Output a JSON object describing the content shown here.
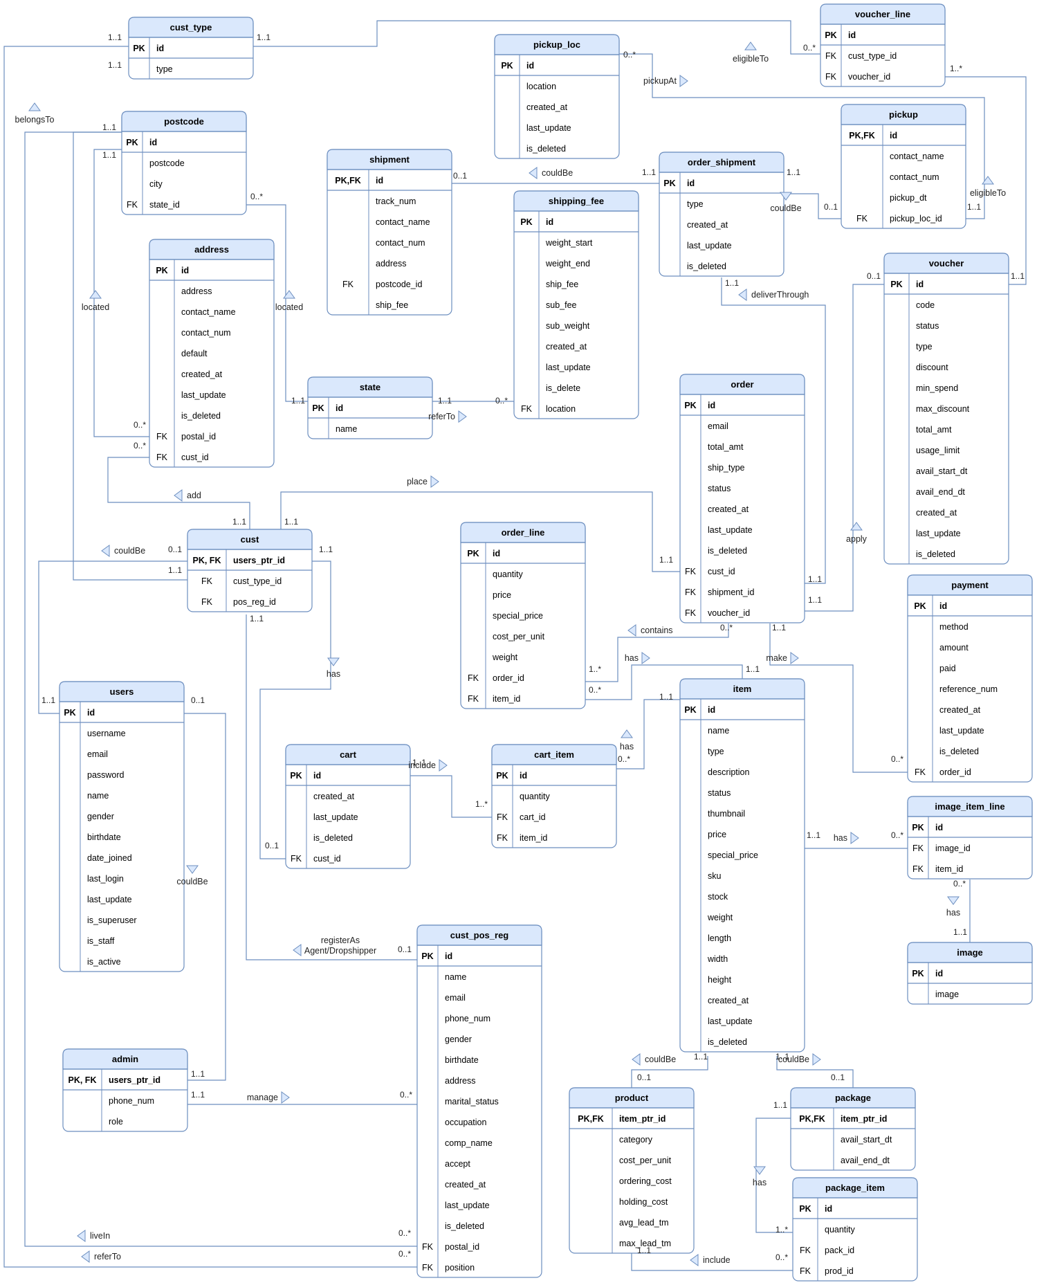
{
  "theme": {
    "line": "#6c8ebf",
    "header": "#dae8fc",
    "border": "#6c8ebf",
    "text": "#000000"
  },
  "entities": [
    {
      "id": "cust_type",
      "title": "cust_type",
      "rows": [
        [
          "PK",
          "id"
        ],
        [
          "",
          "type"
        ]
      ]
    },
    {
      "id": "postcode",
      "title": "postcode",
      "rows": [
        [
          "PK",
          "id"
        ],
        [
          "",
          "postcode"
        ],
        [
          "",
          "city"
        ],
        [
          "FK",
          "state_id"
        ]
      ]
    },
    {
      "id": "address",
      "title": "address",
      "rows": [
        [
          "PK",
          "id"
        ],
        [
          "",
          "address"
        ],
        [
          "",
          "contact_name"
        ],
        [
          "",
          "contact_num"
        ],
        [
          "",
          "default"
        ],
        [
          "",
          "created_at"
        ],
        [
          "",
          "last_update"
        ],
        [
          "",
          "is_deleted"
        ],
        [
          "FK",
          "postal_id"
        ],
        [
          "FK",
          "cust_id"
        ]
      ]
    },
    {
      "id": "shipment",
      "title": "shipment",
      "rows": [
        [
          "PK,FK",
          "id"
        ],
        [
          "",
          "track_num"
        ],
        [
          "",
          "contact_name"
        ],
        [
          "",
          "contact_num"
        ],
        [
          "",
          "address"
        ],
        [
          "FK",
          "postcode_id"
        ],
        [
          "",
          "ship_fee"
        ]
      ]
    },
    {
      "id": "state",
      "title": "state",
      "rows": [
        [
          "PK",
          "id"
        ],
        [
          "",
          "name"
        ]
      ]
    },
    {
      "id": "pickup_loc",
      "title": "pickup_loc",
      "rows": [
        [
          "PK",
          "id"
        ],
        [
          "",
          "location"
        ],
        [
          "",
          "created_at"
        ],
        [
          "",
          "last_update"
        ],
        [
          "",
          "is_deleted"
        ]
      ]
    },
    {
      "id": "shipping_fee",
      "title": "shipping_fee",
      "rows": [
        [
          "PK",
          "id"
        ],
        [
          "",
          "weight_start"
        ],
        [
          "",
          "weight_end"
        ],
        [
          "",
          "ship_fee"
        ],
        [
          "",
          "sub_fee"
        ],
        [
          "",
          "sub_weight"
        ],
        [
          "",
          "created_at"
        ],
        [
          "",
          "last_update"
        ],
        [
          "",
          "is_delete"
        ],
        [
          "FK",
          "location"
        ]
      ]
    },
    {
      "id": "order_shipment",
      "title": "order_shipment",
      "rows": [
        [
          "PK",
          "id"
        ],
        [
          "",
          "type"
        ],
        [
          "",
          "created_at"
        ],
        [
          "",
          "last_update"
        ],
        [
          "",
          "is_deleted"
        ]
      ]
    },
    {
      "id": "voucher_line",
      "title": "voucher_line",
      "rows": [
        [
          "PK",
          "id"
        ],
        [
          "FK",
          "cust_type_id"
        ],
        [
          "FK",
          "voucher_id"
        ]
      ]
    },
    {
      "id": "pickup",
      "title": "pickup",
      "rows": [
        [
          "PK,FK",
          "id"
        ],
        [
          "",
          "contact_name"
        ],
        [
          "",
          "contact_num"
        ],
        [
          "",
          "pickup_dt"
        ],
        [
          "FK",
          "pickup_loc_id"
        ]
      ]
    },
    {
      "id": "voucher",
      "title": "voucher",
      "rows": [
        [
          "PK",
          "id"
        ],
        [
          "",
          "code"
        ],
        [
          "",
          "status"
        ],
        [
          "",
          "type"
        ],
        [
          "",
          "discount"
        ],
        [
          "",
          "min_spend"
        ],
        [
          "",
          "max_discount"
        ],
        [
          "",
          "total_amt"
        ],
        [
          "",
          "usage_limit"
        ],
        [
          "",
          "avail_start_dt"
        ],
        [
          "",
          "avail_end_dt"
        ],
        [
          "",
          "created_at"
        ],
        [
          "",
          "last_update"
        ],
        [
          "",
          "is_deleted"
        ]
      ]
    },
    {
      "id": "order",
      "title": "order",
      "rows": [
        [
          "PK",
          "id"
        ],
        [
          "",
          "email"
        ],
        [
          "",
          "total_amt"
        ],
        [
          "",
          "ship_type"
        ],
        [
          "",
          "status"
        ],
        [
          "",
          "created_at"
        ],
        [
          "",
          "last_update"
        ],
        [
          "",
          "is_deleted"
        ],
        [
          "FK",
          "cust_id"
        ],
        [
          "FK",
          "shipment_id"
        ],
        [
          "FK",
          "voucher_id"
        ]
      ]
    },
    {
      "id": "cust",
      "title": "cust",
      "rows": [
        [
          "PK, FK",
          "users_ptr_id"
        ],
        [
          "FK",
          "cust_type_id"
        ],
        [
          "FK",
          "pos_reg_id"
        ]
      ]
    },
    {
      "id": "order_line",
      "title": "order_line",
      "rows": [
        [
          "PK",
          "id"
        ],
        [
          "",
          "quantity"
        ],
        [
          "",
          "price"
        ],
        [
          "",
          "special_price"
        ],
        [
          "",
          "cost_per_unit"
        ],
        [
          "",
          "weight"
        ],
        [
          "FK",
          "order_id"
        ],
        [
          "FK",
          "item_id"
        ]
      ]
    },
    {
      "id": "payment",
      "title": "payment",
      "rows": [
        [
          "PK",
          "id"
        ],
        [
          "",
          "method"
        ],
        [
          "",
          "amount"
        ],
        [
          "",
          "paid"
        ],
        [
          "",
          "reference_num"
        ],
        [
          "",
          "created_at"
        ],
        [
          "",
          "last_update"
        ],
        [
          "",
          "is_deleted"
        ],
        [
          "FK",
          "order_id"
        ]
      ]
    },
    {
      "id": "users",
      "title": "users",
      "rows": [
        [
          "PK",
          "id"
        ],
        [
          "",
          "username"
        ],
        [
          "",
          "email"
        ],
        [
          "",
          "password"
        ],
        [
          "",
          "name"
        ],
        [
          "",
          "gender"
        ],
        [
          "",
          "birthdate"
        ],
        [
          "",
          "date_joined"
        ],
        [
          "",
          "last_login"
        ],
        [
          "",
          "last_update"
        ],
        [
          "",
          "is_superuser"
        ],
        [
          "",
          "is_staff"
        ],
        [
          "",
          "is_active"
        ]
      ]
    },
    {
      "id": "cart",
      "title": "cart",
      "rows": [
        [
          "PK",
          "id"
        ],
        [
          "",
          "created_at"
        ],
        [
          "",
          "last_update"
        ],
        [
          "",
          "is_deleted"
        ],
        [
          "FK",
          "cust_id"
        ]
      ]
    },
    {
      "id": "cart_item",
      "title": "cart_item",
      "rows": [
        [
          "PK",
          "id"
        ],
        [
          "",
          "quantity"
        ],
        [
          "FK",
          "cart_id"
        ],
        [
          "FK",
          "item_id"
        ]
      ]
    },
    {
      "id": "item",
      "title": "item",
      "rows": [
        [
          "PK",
          "id"
        ],
        [
          "",
          "name"
        ],
        [
          "",
          "type"
        ],
        [
          "",
          "description"
        ],
        [
          "",
          "status"
        ],
        [
          "",
          "thumbnail"
        ],
        [
          "",
          "price"
        ],
        [
          "",
          "special_price"
        ],
        [
          "",
          "sku"
        ],
        [
          "",
          "stock"
        ],
        [
          "",
          "weight"
        ],
        [
          "",
          "length"
        ],
        [
          "",
          "width"
        ],
        [
          "",
          "height"
        ],
        [
          "",
          "created_at"
        ],
        [
          "",
          "last_update"
        ],
        [
          "",
          "is_deleted"
        ]
      ]
    },
    {
      "id": "image_item_line",
      "title": "image_item_line",
      "rows": [
        [
          "PK",
          "id"
        ],
        [
          "FK",
          "image_id"
        ],
        [
          "FK",
          "item_id"
        ]
      ]
    },
    {
      "id": "image",
      "title": "image",
      "rows": [
        [
          "PK",
          "id"
        ],
        [
          "",
          "image"
        ]
      ]
    },
    {
      "id": "cust_pos_reg",
      "title": "cust_pos_reg",
      "rows": [
        [
          "PK",
          "id"
        ],
        [
          "",
          "name"
        ],
        [
          "",
          "email"
        ],
        [
          "",
          "phone_num"
        ],
        [
          "",
          "gender"
        ],
        [
          "",
          "birthdate"
        ],
        [
          "",
          "address"
        ],
        [
          "",
          "marital_status"
        ],
        [
          "",
          "occupation"
        ],
        [
          "",
          "comp_name"
        ],
        [
          "",
          "accept"
        ],
        [
          "",
          "created_at"
        ],
        [
          "",
          "last_update"
        ],
        [
          "",
          "is_deleted"
        ],
        [
          "FK",
          "postal_id"
        ],
        [
          "FK",
          "position"
        ]
      ]
    },
    {
      "id": "admin",
      "title": "admin",
      "rows": [
        [
          "PK, FK",
          "users_ptr_id"
        ],
        [
          "",
          "phone_num"
        ],
        [
          "",
          "role"
        ]
      ]
    },
    {
      "id": "product",
      "title": "product",
      "rows": [
        [
          "PK,FK",
          "item_ptr_id"
        ],
        [
          "",
          "category"
        ],
        [
          "",
          "cost_per_unit"
        ],
        [
          "",
          "ordering_cost"
        ],
        [
          "",
          "holding_cost"
        ],
        [
          "",
          "avg_lead_tm"
        ],
        [
          "",
          "max_lead_tm"
        ]
      ]
    },
    {
      "id": "package",
      "title": "package",
      "rows": [
        [
          "PK,FK",
          "item_ptr_id"
        ],
        [
          "",
          "avail_start_dt"
        ],
        [
          "",
          "avail_end_dt"
        ]
      ]
    },
    {
      "id": "package_item",
      "title": "package_item",
      "rows": [
        [
          "PK",
          "id"
        ],
        [
          "",
          "quantity"
        ],
        [
          "FK",
          "pack_id"
        ],
        [
          "FK",
          "prod_id"
        ]
      ]
    }
  ],
  "relationship_labels": {
    "belongsTo": "belongsTo",
    "eligibleTo_top": "eligibleTo",
    "pickupAt": "pickupAt",
    "eligibleTo_right": "eligibleTo",
    "couldBe_shipment": "couldBe",
    "couldBe_pickup": "couldBe",
    "located_address": "located",
    "located_postcode": "located",
    "deliverThrough": "deliverThrough",
    "referTo_state": "referTo",
    "apply": "apply",
    "place": "place",
    "add": "add",
    "couldBe_cust": "couldBe",
    "contains": "contains",
    "has_orderline": "has",
    "has_cust": "has",
    "make": "make",
    "has_cartitem": "has",
    "include_cart": "include",
    "has_image": "has",
    "has_imageline": "has",
    "couldBe_users": "couldBe",
    "registerAs_1": "registerAs",
    "registerAs_2": "Agent/Dropshipper",
    "manage": "manage",
    "couldBe_product": "couldBe",
    "couldBe_package": "couldBe",
    "has_package": "has",
    "include_package": "include",
    "liveIn": "liveIn",
    "referTo_pos": "referTo"
  },
  "cardinalities": {
    "ct_left": "1..1",
    "ct_left2": "1..1",
    "ct_right": "1..1",
    "vl_left": "0..*",
    "vl_right": "1..*",
    "pl_right": "0..*",
    "pc_left": "1..1",
    "pc_left2": "1..1",
    "pc_right": "0..*",
    "sh_right": "0..1",
    "os_left": "1..1",
    "os_right": "1..1",
    "pu_left": "0..1",
    "pu_right": "1..1",
    "vo_left": "0..1",
    "vo_right": "1..1",
    "st_left": "1..1",
    "st_right": "1..1",
    "sf_left": "0..*",
    "ad_pc": "0..*",
    "ad_cu": "0..*",
    "os_bottom": "1..1",
    "or_cust": "1..1",
    "or_ship": "1..1",
    "or_vou": "1..1",
    "cu_left": "0..1",
    "cu_left2": "1..1",
    "cu_top1": "1..1",
    "cu_top2": "1..1",
    "cu_right": "1..1",
    "cu_bottom": "1..1",
    "ol_order": "1..*",
    "ol_item": "0..*",
    "or_bottom1": "0..*",
    "or_bottom2": "1..1",
    "it_top": "1..1",
    "it_left": "1..1",
    "ci_right": "0..*",
    "pa_left": "0..*",
    "ca_right": "1..1",
    "ci_left": "1..*",
    "ca_left": "0..1",
    "us_left": "1..1",
    "us_right": "0..1",
    "it_right": "1..1",
    "iil_left": "0..*",
    "iil_bottom": "0..*",
    "img_top": "1..1",
    "cpr_reg": "0..1",
    "ad_right1": "1..1",
    "ad_right2": "1..1",
    "cpr_manage": "0..*",
    "it_b1": "1..1",
    "it_b2": "1..1",
    "pr_top": "0..1",
    "pk_top": "0..1",
    "pk_left": "1..1",
    "pki_left": "1..*",
    "pr_bottom": "1..1",
    "pki_bottom": "0..*",
    "cpr_live": "0..*",
    "cpr_refer": "0..*"
  }
}
